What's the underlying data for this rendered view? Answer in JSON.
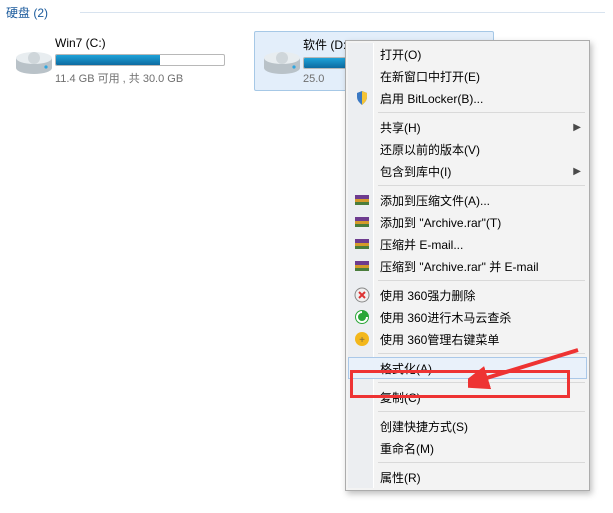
{
  "section": {
    "title": "硬盘 (2)"
  },
  "drives": [
    {
      "name": "Win7 (C:)",
      "sub": "11.4 GB 可用 , 共 30.0 GB",
      "fill_percent": 62,
      "selected": false
    },
    {
      "name": "软件 (D:)",
      "sub": "25.0",
      "fill_percent": 38,
      "selected": true
    }
  ],
  "context_menu": {
    "items": [
      {
        "label": "打开(O)",
        "icon": null,
        "submenu": false
      },
      {
        "label": "在新窗口中打开(E)",
        "icon": null,
        "submenu": false
      },
      {
        "label": "启用 BitLocker(B)...",
        "icon": "shield",
        "submenu": false
      },
      {
        "sep": true
      },
      {
        "label": "共享(H)",
        "icon": null,
        "submenu": true
      },
      {
        "label": "还原以前的版本(V)",
        "icon": null,
        "submenu": false
      },
      {
        "label": "包含到库中(I)",
        "icon": null,
        "submenu": true
      },
      {
        "sep": true
      },
      {
        "label": "添加到压缩文件(A)...",
        "icon": "winrar",
        "submenu": false
      },
      {
        "label": "添加到 \"Archive.rar\"(T)",
        "icon": "winrar",
        "submenu": false
      },
      {
        "label": "压缩并 E-mail...",
        "icon": "winrar",
        "submenu": false
      },
      {
        "label": "压缩到 \"Archive.rar\" 并 E-mail",
        "icon": "winrar",
        "submenu": false
      },
      {
        "sep": true
      },
      {
        "label": "使用 360强力删除",
        "icon": "q360del",
        "submenu": false
      },
      {
        "label": "使用 360进行木马云查杀",
        "icon": "q360scan",
        "submenu": false
      },
      {
        "label": "使用 360管理右键菜单",
        "icon": "q360mgr",
        "submenu": false
      },
      {
        "sep": true
      },
      {
        "label": "格式化(A)...",
        "icon": null,
        "submenu": false,
        "hover": true
      },
      {
        "sep": true
      },
      {
        "label": "复制(C)",
        "icon": null,
        "submenu": false
      },
      {
        "sep": true
      },
      {
        "label": "创建快捷方式(S)",
        "icon": null,
        "submenu": false
      },
      {
        "label": "重命名(M)",
        "icon": null,
        "submenu": false
      },
      {
        "sep": true
      },
      {
        "label": "属性(R)",
        "icon": null,
        "submenu": false
      }
    ]
  }
}
